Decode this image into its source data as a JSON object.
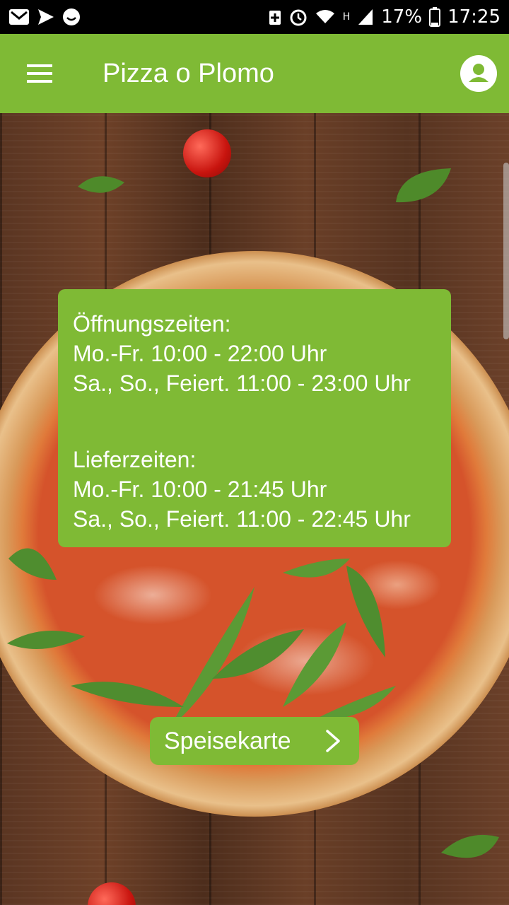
{
  "status_bar": {
    "battery": "17%",
    "time": "17:25",
    "network": "H",
    "icons_left": [
      "gmail-icon",
      "send-icon",
      "smiley-icon"
    ],
    "icons_right": [
      "battery-saver-icon",
      "alarm-icon",
      "wifi-icon",
      "signal-icon",
      "battery-icon"
    ]
  },
  "app_bar": {
    "title": "Pizza o Plomo",
    "menu_icon": "hamburger-icon",
    "account_icon": "account-icon",
    "color": "#7fba35"
  },
  "hours": {
    "opening_title": "Öffnungszeiten:",
    "opening_weekdays": "Mo.-Fr. 10:00 - 22:00 Uhr",
    "opening_weekend": "Sa., So., Feiert. 11:00 - 23:00 Uhr",
    "delivery_title": "Lieferzeiten:",
    "delivery_weekdays": "Mo.-Fr. 10:00 - 21:45 Uhr",
    "delivery_weekend": "Sa., So., Feiert. 11:00 - 22:45 Uhr"
  },
  "menu_button": {
    "label": "Speisekarte",
    "icon": "chevron-right-icon"
  }
}
